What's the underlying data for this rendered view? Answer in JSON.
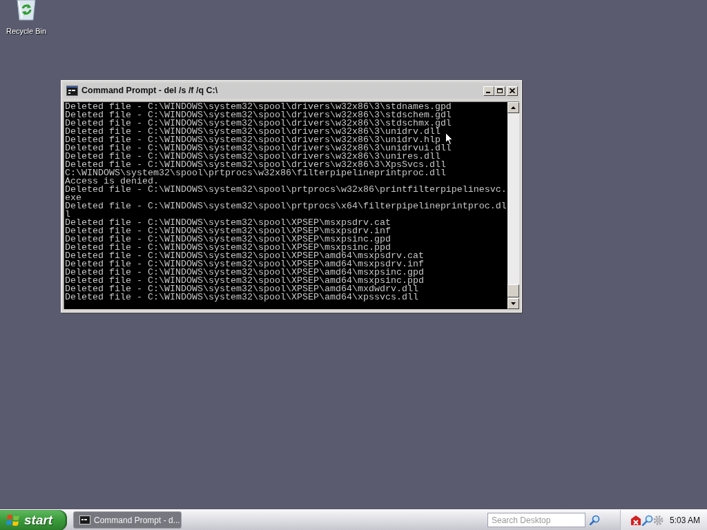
{
  "desktop_icons": [
    {
      "label": "Recycle Bin"
    }
  ],
  "window": {
    "title": "Command Prompt - del /s /f /q C:\\",
    "console_lines": [
      "Deleted file - C:\\WINDOWS\\system32\\spool\\drivers\\w32x86\\3\\stdnames.gpd",
      "Deleted file - C:\\WINDOWS\\system32\\spool\\drivers\\w32x86\\3\\stdschem.gdl",
      "Deleted file - C:\\WINDOWS\\system32\\spool\\drivers\\w32x86\\3\\stdschmx.gdl",
      "Deleted file - C:\\WINDOWS\\system32\\spool\\drivers\\w32x86\\3\\unidrv.dll",
      "Deleted file - C:\\WINDOWS\\system32\\spool\\drivers\\w32x86\\3\\unidrv.hlp",
      "Deleted file - C:\\WINDOWS\\system32\\spool\\drivers\\w32x86\\3\\unidrvui.dll",
      "Deleted file - C:\\WINDOWS\\system32\\spool\\drivers\\w32x86\\3\\unires.dll",
      "Deleted file - C:\\WINDOWS\\system32\\spool\\drivers\\w32x86\\3\\XpsSvcs.dll",
      "C:\\WINDOWS\\system32\\spool\\prtprocs\\w32x86\\filterpipelineprintproc.dll",
      "Access is denied.",
      "Deleted file - C:\\WINDOWS\\system32\\spool\\prtprocs\\w32x86\\printfilterpipelinesvc.",
      "exe",
      "Deleted file - C:\\WINDOWS\\system32\\spool\\prtprocs\\x64\\filterpipelineprintproc.dl",
      "l",
      "Deleted file - C:\\WINDOWS\\system32\\spool\\XPSEP\\msxpsdrv.cat",
      "Deleted file - C:\\WINDOWS\\system32\\spool\\XPSEP\\msxpsdrv.inf",
      "Deleted file - C:\\WINDOWS\\system32\\spool\\XPSEP\\msxpsinc.gpd",
      "Deleted file - C:\\WINDOWS\\system32\\spool\\XPSEP\\msxpsinc.ppd",
      "Deleted file - C:\\WINDOWS\\system32\\spool\\XPSEP\\amd64\\msxpsdrv.cat",
      "Deleted file - C:\\WINDOWS\\system32\\spool\\XPSEP\\amd64\\msxpsdrv.inf",
      "Deleted file - C:\\WINDOWS\\system32\\spool\\XPSEP\\amd64\\msxpsinc.gpd",
      "Deleted file - C:\\WINDOWS\\system32\\spool\\XPSEP\\amd64\\msxpsinc.ppd",
      "Deleted file - C:\\WINDOWS\\system32\\spool\\XPSEP\\amd64\\mxdwdrv.dll",
      "Deleted file - C:\\WINDOWS\\system32\\spool\\XPSEP\\amd64\\xpssvcs.dll"
    ]
  },
  "taskbar": {
    "start_label": "start",
    "tasks": [
      {
        "label": "Command Prompt - d...",
        "selected": false
      }
    ],
    "search": {
      "placeholder": "Search Desktop"
    },
    "clock": "5:03 AM"
  }
}
